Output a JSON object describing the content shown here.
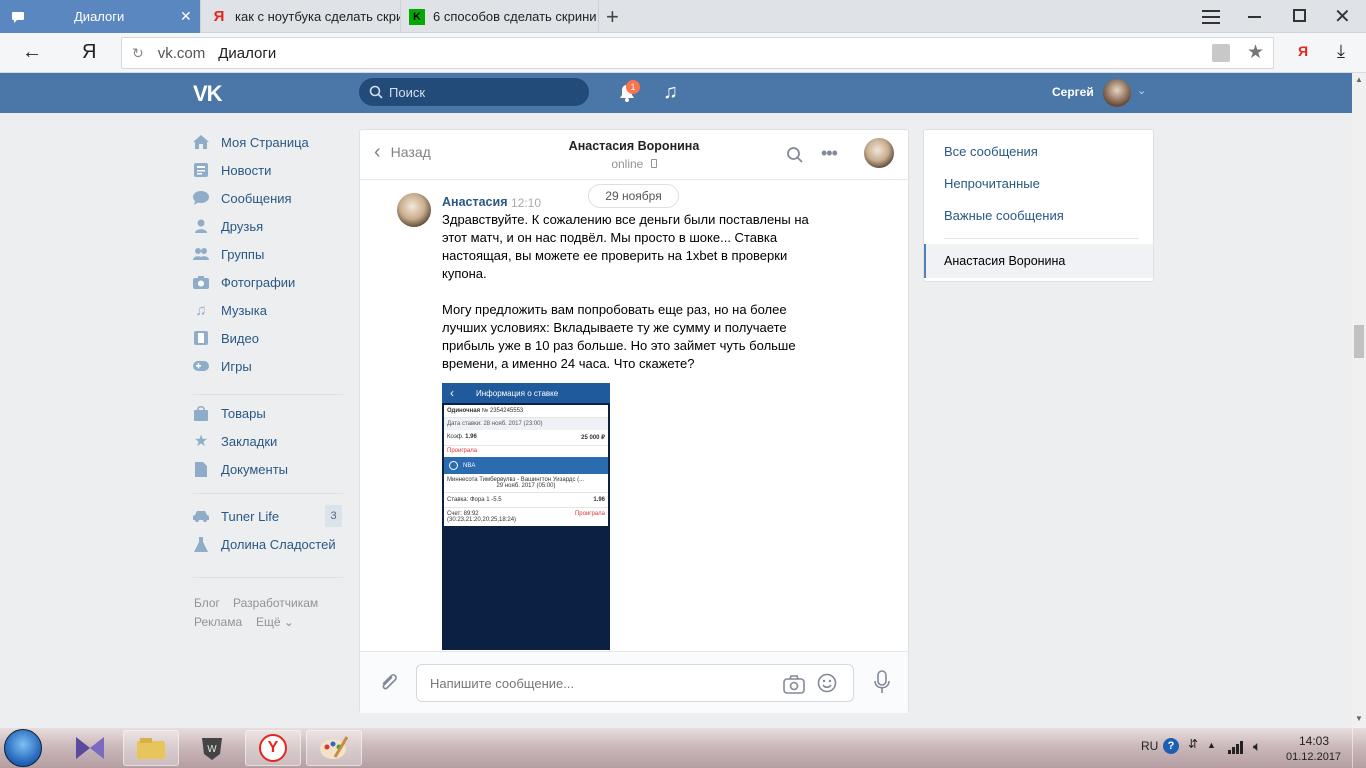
{
  "browser": {
    "tabs": [
      {
        "title": "Диалоги",
        "active": true
      },
      {
        "title": "как с ноутбука сделать скри",
        "active": false
      },
      {
        "title": "6 способов сделать скрини",
        "active": false
      }
    ],
    "new_tab": "+",
    "url_domain": "vk.com",
    "url_page": "Диалоги",
    "yandex_letter": "Я"
  },
  "vk_header": {
    "logo": "VK",
    "search_placeholder": "Поиск",
    "notif_count": "1",
    "user_name": "Сергей"
  },
  "left_menu": {
    "items": [
      {
        "label": "Моя Страница",
        "icon": "home-icon"
      },
      {
        "label": "Новости",
        "icon": "news-icon"
      },
      {
        "label": "Сообщения",
        "icon": "messages-icon"
      },
      {
        "label": "Друзья",
        "icon": "friends-icon"
      },
      {
        "label": "Группы",
        "icon": "groups-icon"
      },
      {
        "label": "Фотографии",
        "icon": "camera-icon"
      },
      {
        "label": "Музыка",
        "icon": "music-icon"
      },
      {
        "label": "Видео",
        "icon": "video-icon"
      },
      {
        "label": "Игры",
        "icon": "games-icon"
      }
    ],
    "items2": [
      {
        "label": "Товары",
        "icon": "bag-icon"
      },
      {
        "label": "Закладки",
        "icon": "star-icon"
      },
      {
        "label": "Документы",
        "icon": "document-icon"
      }
    ],
    "items3": [
      {
        "label": "Tuner Life",
        "icon": "car-icon",
        "badge": "3"
      },
      {
        "label": "Долина Сладостей",
        "icon": "flask-icon"
      }
    ],
    "footer": {
      "blog": "Блог",
      "developers": "Разработчикам",
      "ads": "Реклама",
      "more": "Ещё"
    }
  },
  "chat": {
    "back": "Назад",
    "contact_name": "Анастасия Воронина",
    "status": "online",
    "date_chip": "29 ноября",
    "message": {
      "author": "Анастасия",
      "time": "12:10",
      "p1": "Здравствуйте. К сожалению все деньги были поставлены на этот матч, и он нас подвёл. Мы просто в шоке... Ставка настоящая, вы можете ее проверить на 1xbet в проверки купона.",
      "p2": "Могу предложить вам попробовать еще раз, но на более лучших условиях: Вкладываете ту же сумму и получаете прибыль уже в 10 раз больше. Но это займет чуть больше времени, а именно 24 часа. Что скажете?"
    },
    "bet_screenshot": {
      "header": "Информация о ставке",
      "single": "Одиночная",
      "number": "№ 2354245553",
      "date": "Дата ставки: 28 нояб. 2017 (23:00)",
      "coef_label": "Коэф.",
      "coef": "1.96",
      "amount": "25 000 ₽",
      "lost": "Проиграла",
      "league": "NBA",
      "match": "Миннесота Тимбервулвз - Вашингтон Уизардс (...",
      "match_date": "29 нояб. 2017 (05:00)",
      "bet": "Ставка: Фора 1 -5.5",
      "bet_coef": "1.96",
      "score": "Счет: 89:92",
      "score_detail": "(30:23,21:20,20:25,18:24)",
      "result": "Проиграла"
    },
    "input_placeholder": "Напишите сообщение..."
  },
  "right_panel": {
    "all": "Все сообщения",
    "unread": "Непрочитанные",
    "important": "Важные сообщения",
    "selected": "Анастасия Воронина"
  },
  "taskbar": {
    "lang": "RU",
    "time": "14:03",
    "date": "01.12.2017"
  }
}
